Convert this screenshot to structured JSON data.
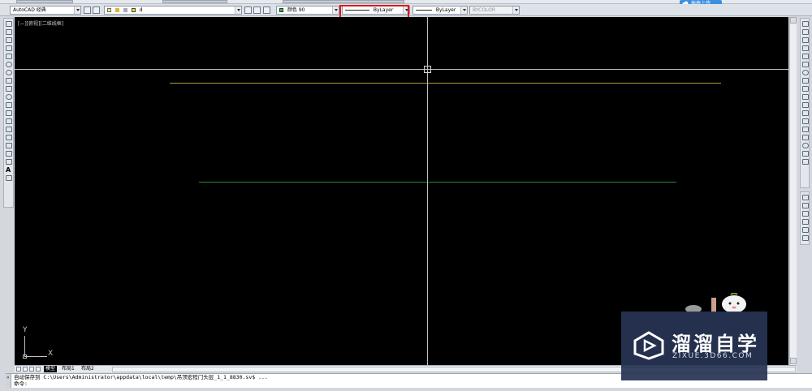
{
  "topbar": {
    "upload_label": "拖拽上传"
  },
  "properties": {
    "workspace": "AutoCAD 经典",
    "layer": "d",
    "color": "颜色 90",
    "linetype": "ByLayer",
    "lineweight": "ByLayer",
    "plotstyle": "BYCOLOR"
  },
  "viewport": {
    "label": "[—][俯视][二维线框]"
  },
  "ucs": {
    "x_label": "X",
    "y_label": "Y"
  },
  "tabs": [
    "模型",
    "布局1",
    "布局2"
  ],
  "command": {
    "history": "自动保存到 C:\\Users\\Administrator\\appdata\\local\\temp\\吊顶宏程门头层_1_1_8830.sv$ ...",
    "prompt": "命令:"
  },
  "watermark": {
    "brand": "溜溜自学",
    "url": "ZIXUE.3D66.COM"
  },
  "colors": {
    "canvas": "#000000",
    "line_yellow": "#b59540",
    "line_green": "#2d8a36",
    "crosshair": "#bfbfbf",
    "highlight": "#e0191b"
  }
}
